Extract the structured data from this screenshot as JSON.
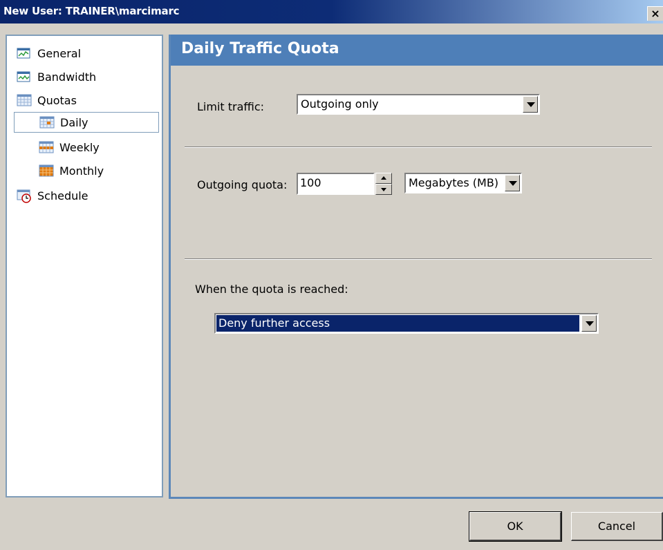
{
  "window": {
    "title": "New User: TRAINER\\marcimarc",
    "close_label": "×"
  },
  "tree": {
    "items": [
      {
        "label": "General",
        "icon": "general-icon"
      },
      {
        "label": "Bandwidth",
        "icon": "bandwidth-icon"
      },
      {
        "label": "Quotas",
        "icon": "calendar-icon"
      },
      {
        "label": "Daily",
        "icon": "calendar-day-icon",
        "selected": true
      },
      {
        "label": "Weekly",
        "icon": "calendar-week-icon"
      },
      {
        "label": "Monthly",
        "icon": "calendar-month-icon"
      },
      {
        "label": "Schedule",
        "icon": "schedule-clock-icon"
      }
    ]
  },
  "panel": {
    "title": "Daily Traffic Quota",
    "limit_traffic_label": "Limit traffic:",
    "limit_traffic_value": "Outgoing only",
    "outgoing_quota_label": "Outgoing quota:",
    "outgoing_quota_value": "100",
    "unit_value": "Megabytes (MB)",
    "when_reached_label": "When the quota is reached:",
    "when_reached_value": "Deny further access"
  },
  "buttons": {
    "ok": "OK",
    "cancel": "Cancel"
  },
  "colors": {
    "titlebar": "#0a246a",
    "panel_header": "#4e7fb8",
    "selection": "#0a246a",
    "dialog_bg": "#d4d0c8"
  }
}
